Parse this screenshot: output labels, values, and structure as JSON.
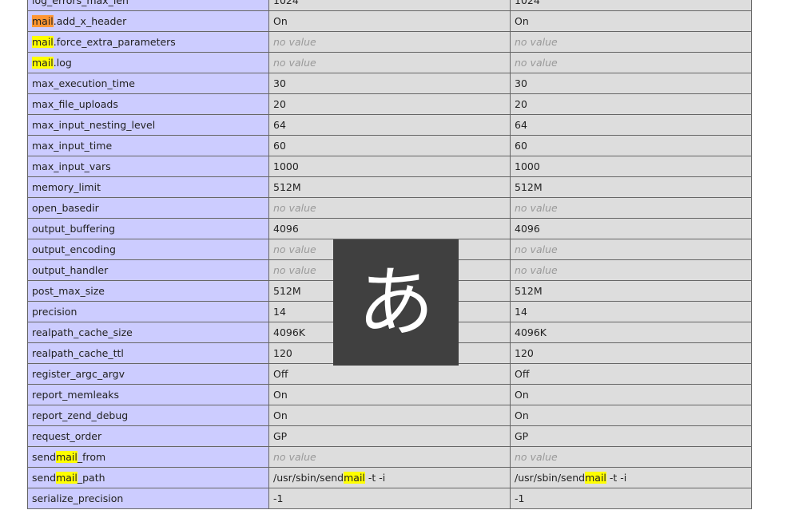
{
  "rows": [
    {
      "directive": "log_errors_max_len",
      "local": "1024",
      "master": "1024"
    },
    {
      "pre": "",
      "hl": "mail",
      "post": ".add_x_header",
      "local": "On",
      "master": "On"
    },
    {
      "pre": "",
      "hl": "mail",
      "post": ".force_extra_parameters",
      "local": "no value",
      "master": "no value"
    },
    {
      "pre": "",
      "hl": "mail",
      "post": ".log",
      "local": "no value",
      "master": "no value"
    },
    {
      "directive": "max_execution_time",
      "local": "30",
      "master": "30"
    },
    {
      "directive": "max_file_uploads",
      "local": "20",
      "master": "20"
    },
    {
      "directive": "max_input_nesting_level",
      "local": "64",
      "master": "64"
    },
    {
      "directive": "max_input_time",
      "local": "60",
      "master": "60"
    },
    {
      "directive": "max_input_vars",
      "local": "1000",
      "master": "1000"
    },
    {
      "directive": "memory_limit",
      "local": "512M",
      "master": "512M"
    },
    {
      "directive": "open_basedir",
      "local": "no value",
      "master": "no value"
    },
    {
      "directive": "output_buffering",
      "local": "4096",
      "master": "4096"
    },
    {
      "directive": "output_encoding",
      "local": "no value",
      "master": "no value"
    },
    {
      "directive": "output_handler",
      "local": "no value",
      "master": "no value"
    },
    {
      "directive": "post_max_size",
      "local": "512M",
      "master": "512M"
    },
    {
      "directive": "precision",
      "local": "14",
      "master": "14"
    },
    {
      "directive": "realpath_cache_size",
      "local": "4096K",
      "master": "4096K"
    },
    {
      "directive": "realpath_cache_ttl",
      "local": "120",
      "master": "120"
    },
    {
      "directive": "register_argc_argv",
      "local": "Off",
      "master": "Off"
    },
    {
      "directive": "report_memleaks",
      "local": "On",
      "master": "On"
    },
    {
      "directive": "report_zend_debug",
      "local": "On",
      "master": "On"
    },
    {
      "directive": "request_order",
      "local": "GP",
      "master": "GP"
    },
    {
      "pre": "send",
      "hl": "mail",
      "post": "_from",
      "local": "no value",
      "master": "no value"
    },
    {
      "pre": "send",
      "hl": "mail",
      "post": "_path",
      "local_pre": "/usr/sbin/send",
      "local_hl": "mail",
      "local_post": " -t -i",
      "master_pre": "/usr/sbin/send",
      "master_hl": "mail",
      "master_post": " -t -i"
    },
    {
      "directive": "serialize_precision",
      "local": "-1",
      "master": "-1"
    }
  ],
  "ime_indicator": {
    "glyph": "あ"
  },
  "colors": {
    "directive_bg": "#ccccff",
    "value_bg": "#dddddd",
    "no_value_text": "#999999",
    "find_highlight": "#ffff00",
    "find_current": "#ff9632"
  }
}
